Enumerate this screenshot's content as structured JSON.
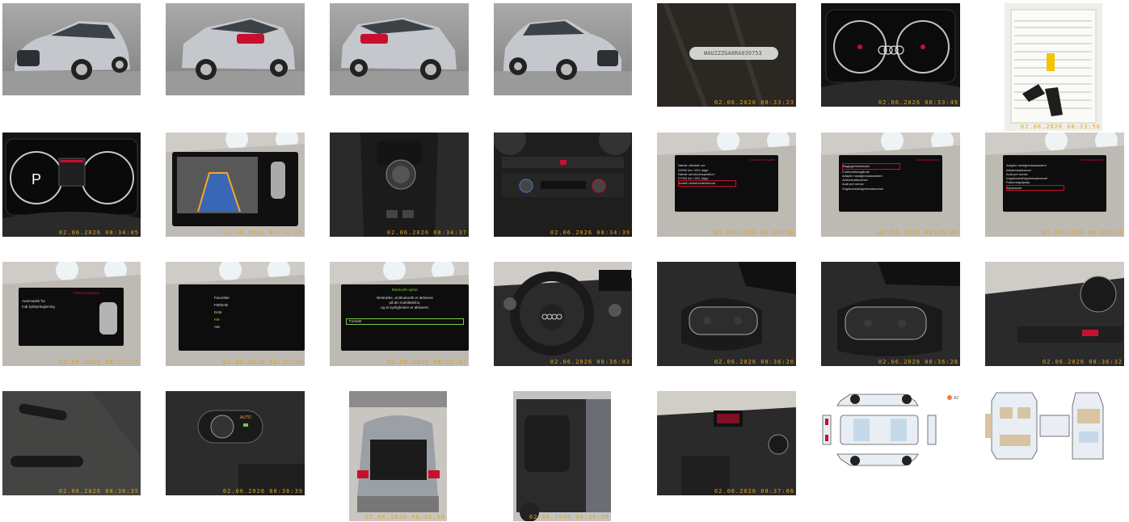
{
  "photos": [
    {
      "id": "ext-front-left",
      "kind": "car-studio",
      "stamp": ""
    },
    {
      "id": "ext-rear-left",
      "kind": "car-studio",
      "stamp": ""
    },
    {
      "id": "ext-rear-right",
      "kind": "car-studio",
      "stamp": ""
    },
    {
      "id": "ext-front-right",
      "kind": "car-studio",
      "stamp": ""
    },
    {
      "id": "vin-plate",
      "kind": "vin",
      "stamp": "02.06.2026 08:33:23",
      "vin": "WAUZZZGA6RA039753"
    },
    {
      "id": "cluster-mileage",
      "kind": "cluster",
      "stamp": "02.06.2026 08:33:49"
    },
    {
      "id": "service-book-keys",
      "kind": "document",
      "stamp": "02.06.2026 08:33:56"
    },
    {
      "id": "cluster-park",
      "kind": "cluster",
      "stamp": "02.06.2026 08:34:05"
    },
    {
      "id": "rear-camera",
      "kind": "screen",
      "stamp": "02.06.2026 08:34:29"
    },
    {
      "id": "center-console",
      "kind": "console",
      "stamp": "02.06.2026 08:34:37"
    },
    {
      "id": "climate-panel",
      "kind": "climate",
      "stamp": "02.06.2026 08:34:39"
    },
    {
      "id": "mmi-service",
      "kind": "screen",
      "stamp": "02.06.2026 08:34:56"
    },
    {
      "id": "mmi-assist-1",
      "kind": "screen",
      "stamp": "02.06.2026 08:35:06"
    },
    {
      "id": "mmi-assist-2",
      "kind": "screen",
      "stamp": "02.06.2026 08:35:14"
    },
    {
      "id": "mmi-parking",
      "kind": "screen",
      "stamp": "02.06.2026 08:35:29"
    },
    {
      "id": "mmi-radio",
      "kind": "screen",
      "stamp": "02.06.2026 08:35:38"
    },
    {
      "id": "mmi-bluetooth",
      "kind": "screen",
      "stamp": "02.06.2026 08:35:47"
    },
    {
      "id": "steering-wheel",
      "kind": "interior",
      "stamp": "02.06.2026 08:36:03"
    },
    {
      "id": "wheel-left-buttons",
      "kind": "interior",
      "stamp": "02.06.2026 08:36:20"
    },
    {
      "id": "wheel-right-buttons",
      "kind": "interior",
      "stamp": "02.06.2026 08:36:28"
    },
    {
      "id": "dash-vent",
      "kind": "interior",
      "stamp": "02.06.2026 08:36:32"
    },
    {
      "id": "stalk-left",
      "kind": "interior",
      "stamp": "02.06.2026 08:36:35"
    },
    {
      "id": "light-switch",
      "kind": "interior",
      "stamp": "02.06.2026 08:36:39"
    },
    {
      "id": "trunk-open",
      "kind": "trunk",
      "stamp": "02.06.2026 08:36:50"
    },
    {
      "id": "rear-seats",
      "kind": "door",
      "stamp": "02.06.2026 08:36:58"
    },
    {
      "id": "dashboard-wide",
      "kind": "interior",
      "stamp": "02.06.2026 08:37:06"
    },
    {
      "id": "damage-diagram-exterior",
      "kind": "diagram",
      "stamp": ""
    },
    {
      "id": "damage-diagram-interior",
      "kind": "diagram",
      "stamp": ""
    }
  ],
  "screens": {
    "mmi-service": {
      "header": "Service intervaller",
      "lines": [
        "Næste olieskift om:",
        "29000 km / 691 dage",
        "Næste service/inspektion:",
        "27000 km / 691 dage",
        "Indstil oliebeholdeinterval"
      ],
      "footer": "Tilbage"
    },
    "mmi-assist-1": {
      "header": "Førerassistance",
      "lines": [
        "Baglygtebrækstrøl",
        "Forbindelsesgånde",
        "Adaptiv hastighedsassistent",
        "Aktiverbaltsvarsel",
        "Audi pre sense",
        "Vognbaneafvigelsesadvarsel"
      ],
      "footer": ""
    },
    "mmi-assist-2": {
      "header": "Førerassistance",
      "lines": [
        "Adaptiv hastighedsassistent",
        "Afstandsadvarsel",
        "Audi pre sense",
        "Vognbaneafvigelsesadvarsel",
        "Parkeringshjælp",
        "Nystramer"
      ],
      "footer": ""
    },
    "mmi-parking": {
      "header": "Parkeringshjælp",
      "lines": [
        "Automatisk fra",
        "Indt lydstyrkegivning"
      ],
      "footer": ""
    },
    "mmi-radio": {
      "header": "",
      "lines": [
        "Favoritter",
        "FM/DAB",
        "DAB",
        "FM",
        "AM"
      ],
      "footer": ""
    },
    "mmi-bluetooth": {
      "header": "Bluetooth-ophør",
      "lines": [
        "Bestræbe, at Bluetooth er aktiveret",
        "på din mobiltelefon,",
        "og at synligheden er aktiveret.",
        "Fortsæt"
      ],
      "footer": ""
    }
  },
  "diagram_legend": {
    "label": "A2",
    "color": "#f47a45"
  }
}
